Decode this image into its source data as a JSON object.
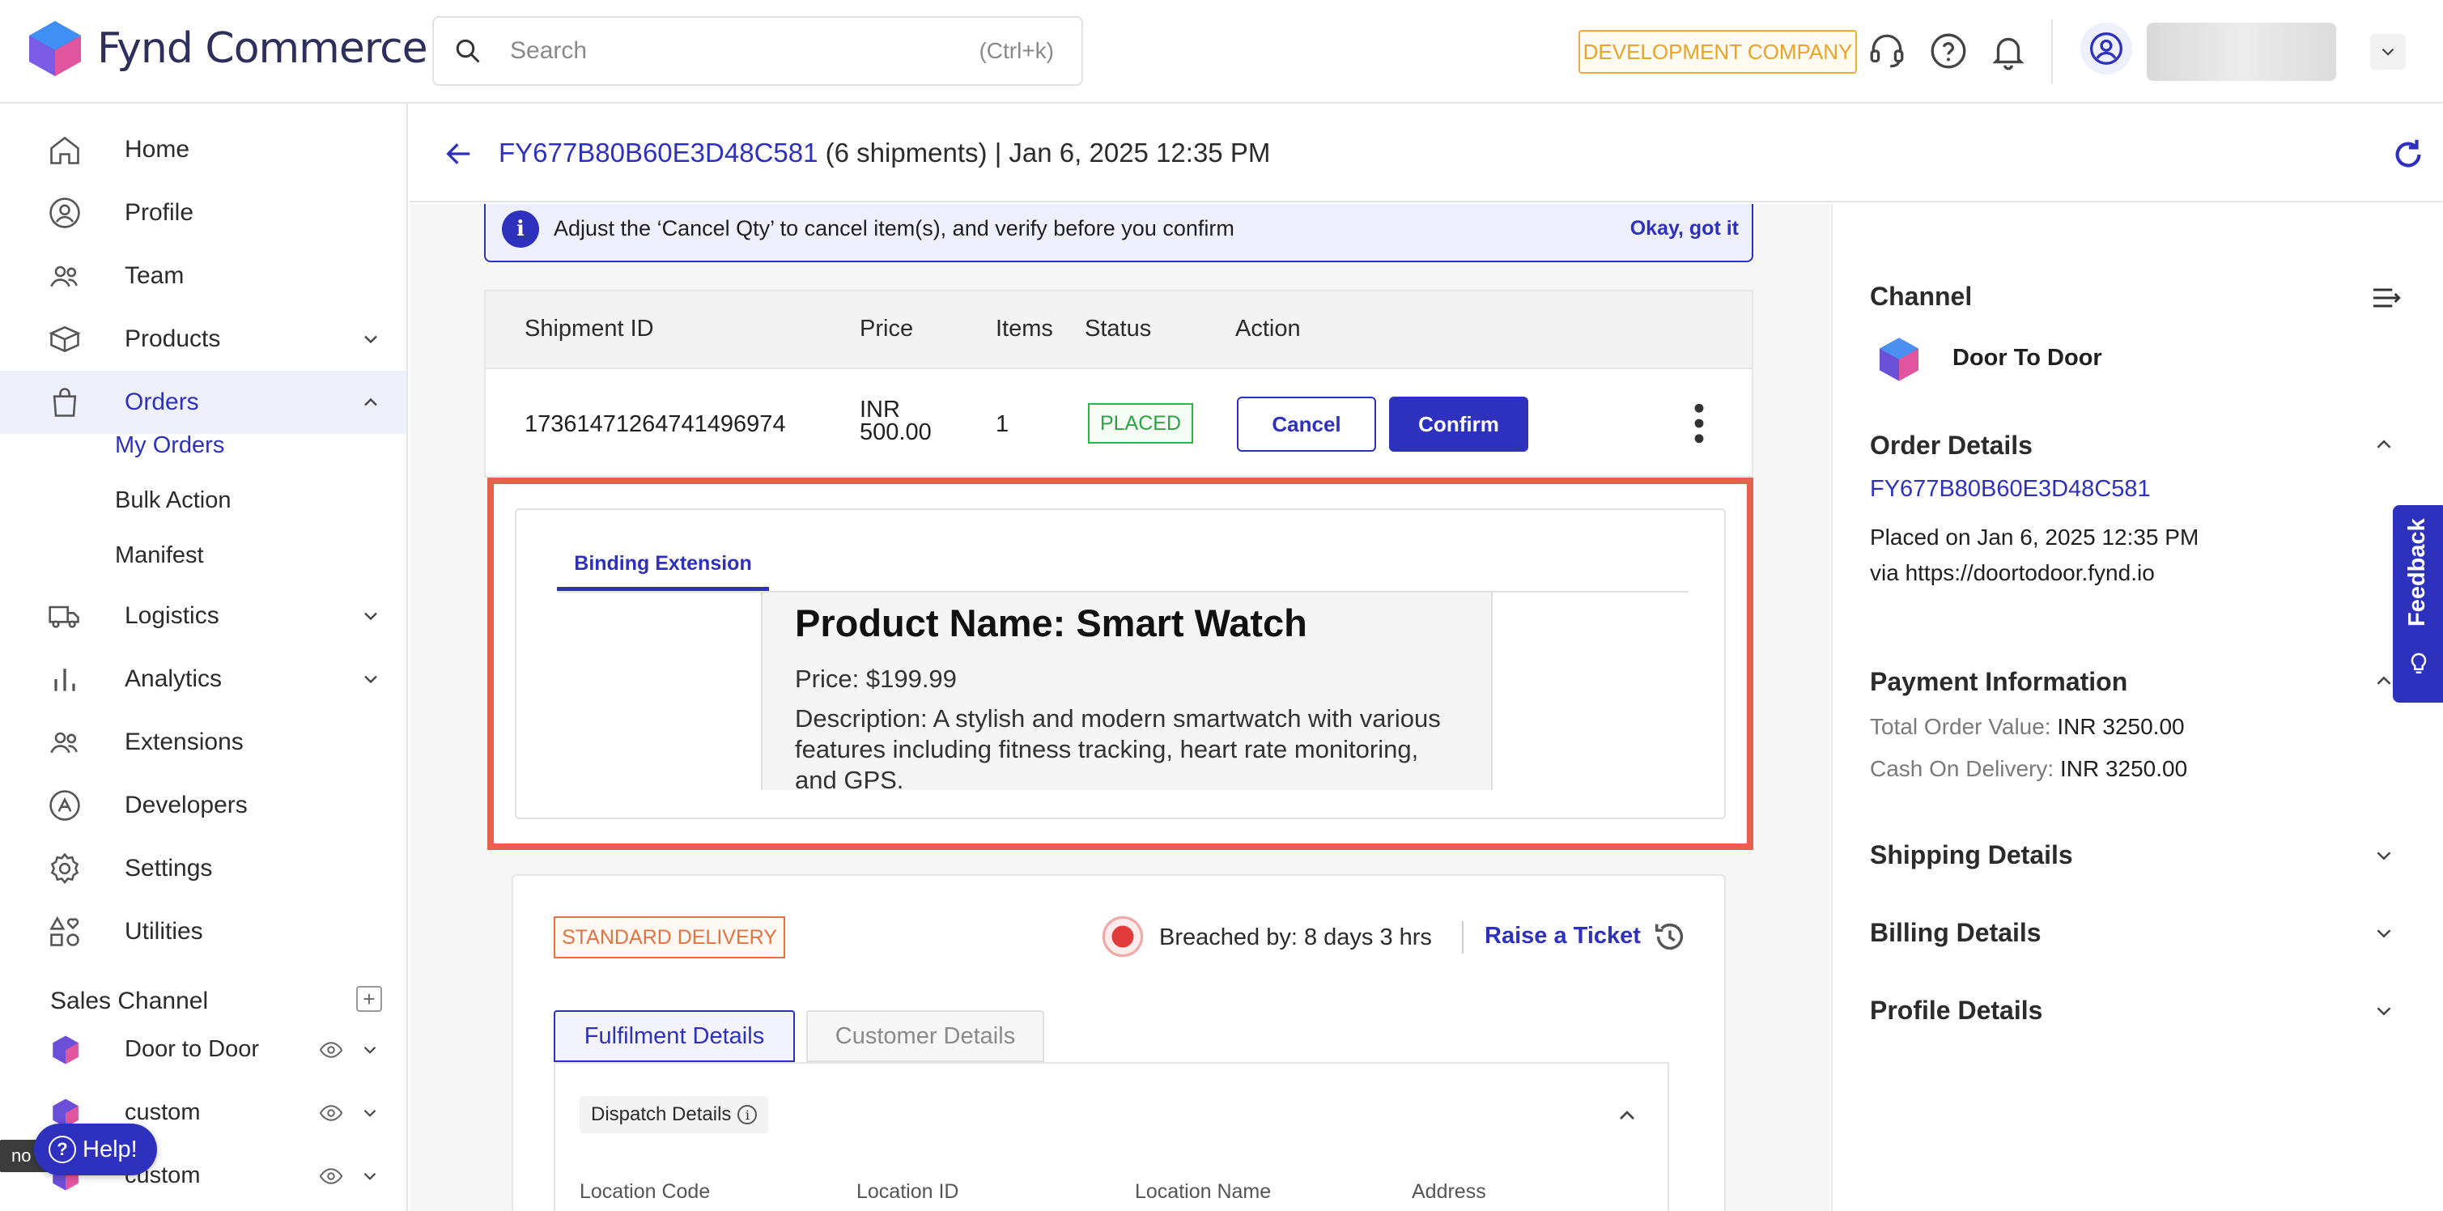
{
  "brand": {
    "name": "Fynd Commerce"
  },
  "search": {
    "placeholder": "Search",
    "shortcut": "(Ctrl+k)"
  },
  "topbar": {
    "company_badge": "DEVELOPMENT COMPANY"
  },
  "sidebar": {
    "items": [
      {
        "label": "Home"
      },
      {
        "label": "Profile"
      },
      {
        "label": "Team"
      },
      {
        "label": "Products"
      },
      {
        "label": "Orders"
      },
      {
        "label": "Logistics"
      },
      {
        "label": "Analytics"
      },
      {
        "label": "Extensions"
      },
      {
        "label": "Developers"
      },
      {
        "label": "Settings"
      },
      {
        "label": "Utilities"
      }
    ],
    "orders_sub": [
      "My Orders",
      "Bulk Action",
      "Manifest"
    ],
    "sales_channel_title": "Sales Channel",
    "sales_add": "+",
    "channels": [
      "Door to Door",
      "custom",
      "custom"
    ],
    "tooltip": "no custom",
    "help": "Help!"
  },
  "order_header": {
    "order_id": "FY677B80B60E3D48C581",
    "rest": "(6 shipments) | Jan 6, 2025 12:35 PM"
  },
  "banner": {
    "icon": "i",
    "message": "Adjust the ‘Cancel Qty’ to cancel item(s), and verify before you confirm",
    "dismiss": "Okay, got it"
  },
  "shipment_table": {
    "headers": [
      "Shipment ID",
      "Price",
      "Items",
      "Status",
      "Action"
    ],
    "row": {
      "shipment_id": "17361471264741496974",
      "price_currency": "INR",
      "price_value": "500.00",
      "items": "1",
      "status": "PLACED",
      "cancel": "Cancel",
      "confirm": "Confirm"
    }
  },
  "extension": {
    "tab": "Binding Extension",
    "product_name": "Product Name: Smart Watch",
    "price": "Price: $199.99",
    "description": "Description: A stylish and modern smartwatch with various features including fitness tracking, heart rate monitoring, and GPS."
  },
  "delivery": {
    "badge": "STANDARD DELIVERY",
    "breached": "Breached by: 8 days 3 hrs",
    "raise_ticket": "Raise a Ticket",
    "tabs": [
      "Fulfilment Details",
      "Customer Details"
    ],
    "dispatch_title": "Dispatch Details",
    "dispatch_info": "i",
    "columns": [
      "Location Code",
      "Location ID",
      "Location Name",
      "Address"
    ]
  },
  "right_panel": {
    "channel_title": "Channel",
    "channel_name": "Door To Door",
    "order_details_title": "Order Details",
    "order_id": "FY677B80B60E3D48C581",
    "placed_on": "Placed on Jan 6, 2025 12:35 PM",
    "via": "via https://doortodoor.fynd.io",
    "payment_title": "Payment Information",
    "total_label": "Total Order Value:",
    "total_value": "INR 3250.00",
    "cod_label": "Cash On Delivery:",
    "cod_value": "INR 3250.00",
    "shipping_title": "Shipping Details",
    "billing_title": "Billing Details",
    "profile_title": "Profile Details"
  },
  "feedback": {
    "label": "Feedback"
  },
  "colors": {
    "accent": "#2e31be",
    "highlight_frame": "#e8604c",
    "placed_green": "#33b24a",
    "standard_orange": "#e2733f",
    "dev_badge": "#f2a93b"
  }
}
